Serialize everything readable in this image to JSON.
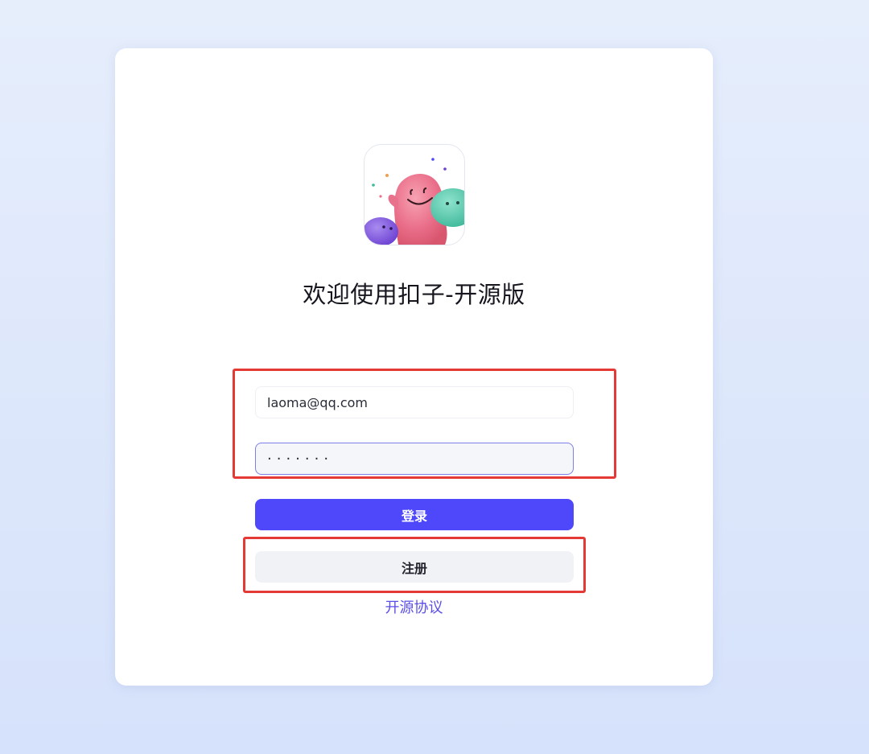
{
  "page": {
    "background_colors": [
      "#e6eefc",
      "#d6e2fb"
    ]
  },
  "logo": {
    "icon": "mascot-logo-icon"
  },
  "welcome": {
    "title": "欢迎使用扣子-开源版"
  },
  "form": {
    "email_value": "laoma@qq.com",
    "password_value": "·······",
    "login_label": "登录",
    "register_label": "注册",
    "license_link": "开源协议"
  },
  "colors": {
    "primary": "#4f48fb",
    "secondary_button": "#f1f2f6",
    "link": "#5b4fe8",
    "annotation": "#e53935"
  }
}
